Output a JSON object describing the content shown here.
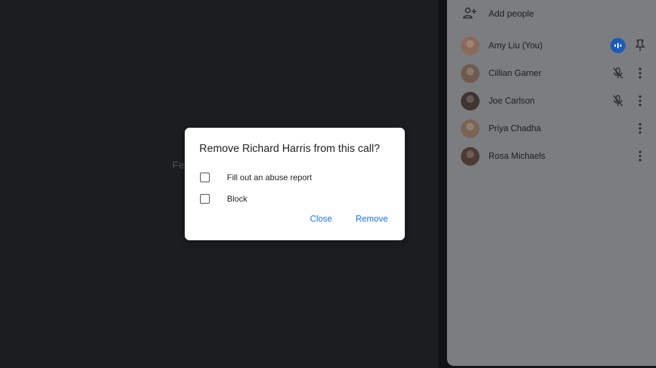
{
  "background": {
    "partial_text": "Fe"
  },
  "panel": {
    "add_people_label": "Add people",
    "participants": [
      {
        "name": "Amy Liu (You)",
        "avatar_color": "#8a6a5a",
        "status": "speaking",
        "action": "pin-icon"
      },
      {
        "name": "Cillian Garner",
        "avatar_color": "#6e5a4e",
        "status": "muted",
        "action": "more-vert-icon"
      },
      {
        "name": "Joe Carlson",
        "avatar_color": "#3f3430",
        "status": "muted",
        "action": "more-vert-icon"
      },
      {
        "name": "Priya Chadha",
        "avatar_color": "#7b6355",
        "status": "",
        "action": "more-vert-icon"
      },
      {
        "name": "Rosa Michaels",
        "avatar_color": "#4d3a33",
        "status": "",
        "action": "more-vert-icon"
      }
    ]
  },
  "dialog": {
    "title": "Remove Richard Harris from this call?",
    "options": [
      {
        "label": "Fill out an abuse report",
        "checked": false
      },
      {
        "label": "Block",
        "checked": false
      }
    ],
    "close_label": "Close",
    "remove_label": "Remove"
  },
  "colors": {
    "accent": "#1a73e8",
    "speaking_badge": "#1a5bb8"
  }
}
